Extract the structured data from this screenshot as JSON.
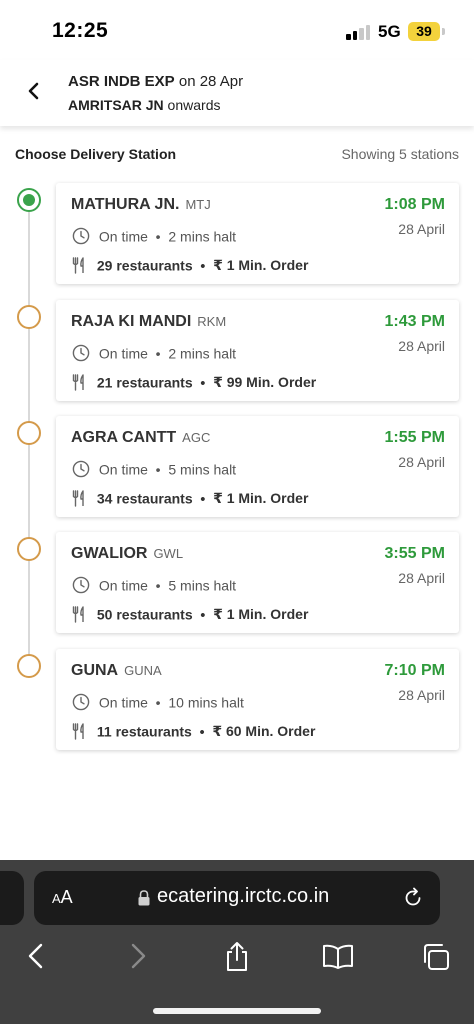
{
  "status_bar": {
    "time": "12:25",
    "network": "5G",
    "battery": "39"
  },
  "header": {
    "train": "ASR INDB EXP",
    "date_text": " on 28 Apr",
    "station": "AMRITSAR JN",
    "suffix": " onwards"
  },
  "section": {
    "title": "Choose Delivery Station",
    "count": "Showing 5 stations"
  },
  "stations": [
    {
      "name": "MATHURA JN.",
      "code": "MTJ",
      "time": "1:08 PM",
      "date": "28 April",
      "status": "On time",
      "halt": "2 mins halt",
      "restaurants": "29 restaurants",
      "min_order": "₹ 1 Min. Order",
      "selected": true
    },
    {
      "name": "RAJA KI MANDI",
      "code": "RKM",
      "time": "1:43 PM",
      "date": "28 April",
      "status": "On time",
      "halt": "2 mins halt",
      "restaurants": "21 restaurants",
      "min_order": "₹ 99 Min. Order",
      "selected": false
    },
    {
      "name": "AGRA CANTT",
      "code": "AGC",
      "time": "1:55 PM",
      "date": "28 April",
      "status": "On time",
      "halt": "5 mins halt",
      "restaurants": "34 restaurants",
      "min_order": "₹ 1 Min. Order",
      "selected": false
    },
    {
      "name": "GWALIOR",
      "code": "GWL",
      "time": "3:55 PM",
      "date": "28 April",
      "status": "On time",
      "halt": "5 mins halt",
      "restaurants": "50 restaurants",
      "min_order": "₹ 1 Min. Order",
      "selected": false
    },
    {
      "name": "GUNA",
      "code": "GUNA",
      "time": "7:10 PM",
      "date": "28 April",
      "status": "On time",
      "halt": "10 mins halt",
      "restaurants": "11 restaurants",
      "min_order": "₹ 60 Min. Order",
      "selected": false
    }
  ],
  "separator": "•",
  "browser": {
    "aa_small": "A",
    "aa_large": "A",
    "url": "ecatering.irctc.co.in"
  },
  "icons": {
    "back": "chevron-left-icon",
    "clock": "clock-icon",
    "restaurants": "fork-knife-icon",
    "lock": "lock-icon",
    "reload": "reload-icon",
    "nav_back": "chevron-left-icon",
    "nav_forward": "chevron-right-icon",
    "share": "share-icon",
    "bookmarks": "book-icon",
    "tabs": "tabs-icon"
  },
  "colors": {
    "accent_green": "#2e9a3b",
    "active_node": "#3aa34b",
    "pending_node": "#d49a4a",
    "battery": "#f3d23c",
    "browser_bar": "#404040"
  }
}
